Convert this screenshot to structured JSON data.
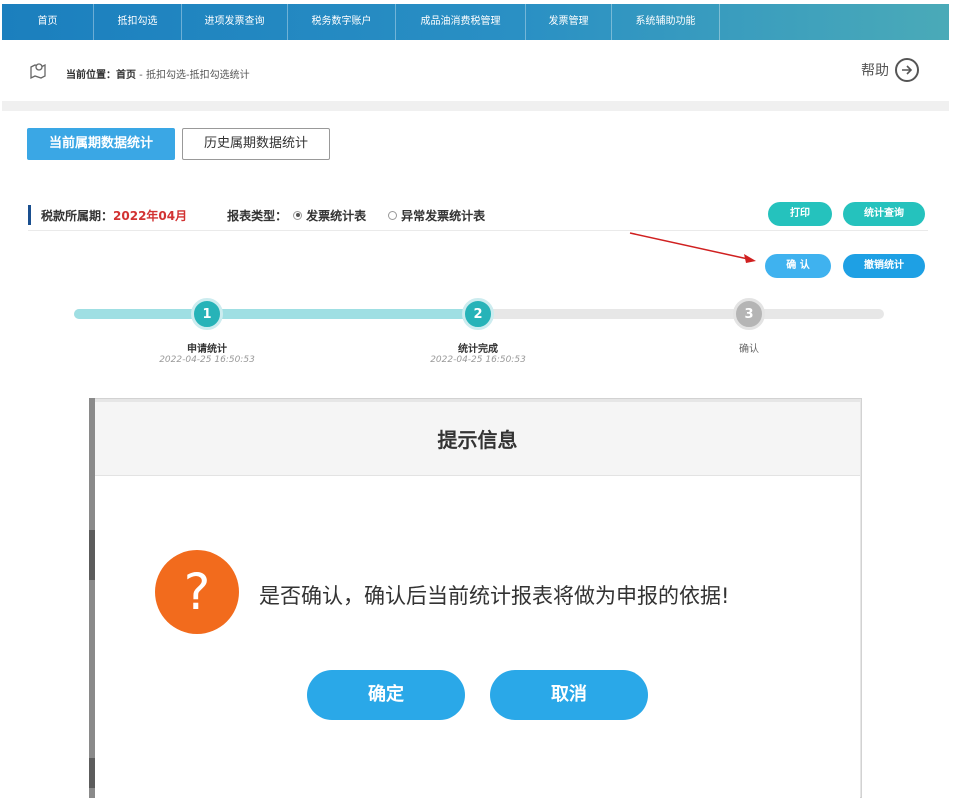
{
  "nav": {
    "items": [
      "首页",
      "抵扣勾选",
      "进项发票查询",
      "税务数字账户",
      "成品油消费税管理",
      "发票管理",
      "系统辅助功能"
    ]
  },
  "breadcrumb": {
    "prefix": "当前位置：首页",
    "path": " - 抵扣勾选-抵扣勾选统计"
  },
  "help": {
    "label": "帮助"
  },
  "tabs": {
    "current": "当前属期数据统计",
    "history": "历史属期数据统计"
  },
  "info": {
    "period_label": "税款所属期：",
    "period_value": "2022年04月",
    "type_label": "报表类型：",
    "options": [
      "发票统计表",
      "异常发票统计表"
    ],
    "selected": "发票统计表"
  },
  "buttons": {
    "print": "打印",
    "query": "统计查询",
    "confirm": "确 认",
    "revoke": "撤销统计"
  },
  "steps": [
    {
      "num": "1",
      "label": "申请统计",
      "time": "2022-04-25 16:50:53",
      "status": "done"
    },
    {
      "num": "2",
      "label": "统计完成",
      "time": "2022-04-25 16:50:53",
      "status": "done"
    },
    {
      "num": "3",
      "label": "确认",
      "time": "",
      "status": "todo"
    }
  ],
  "modal": {
    "title": "提示信息",
    "message": "是否确认，确认后当前统计报表将做为申报的依据!",
    "icon": "question-icon",
    "ok": "确定",
    "cancel": "取消"
  },
  "colors": {
    "nav": "#1b7fbe",
    "teal": "#25c2bd",
    "blue": "#2aa8e8",
    "orange": "#f26b1d",
    "period_red": "#d23232"
  }
}
